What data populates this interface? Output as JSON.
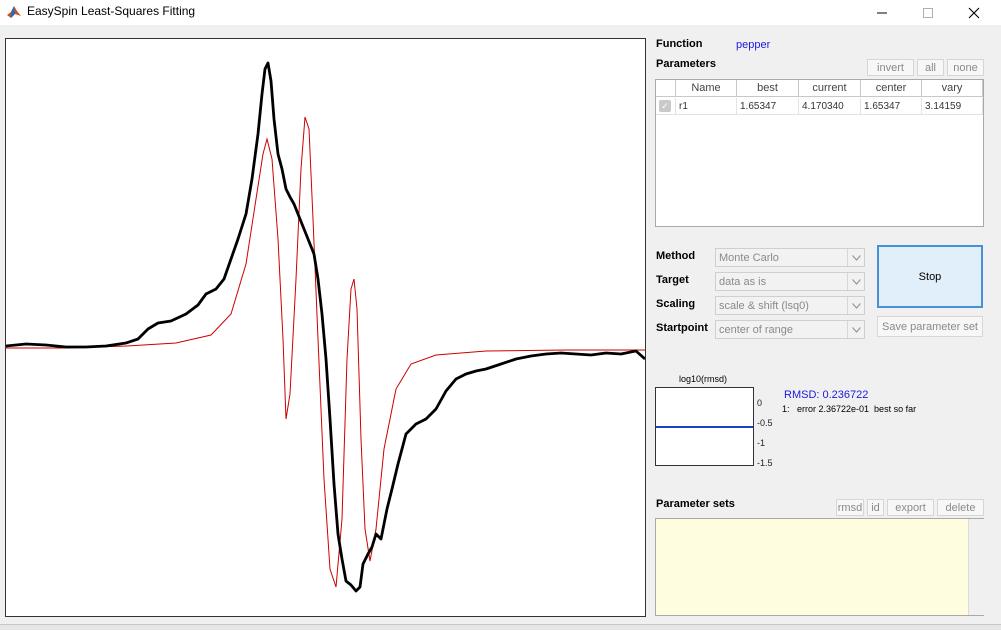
{
  "window": {
    "title": "EasySpin Least-Squares Fitting",
    "icon": "matlab-icon",
    "controls": [
      "minimize-icon",
      "maximize-icon",
      "close-icon"
    ]
  },
  "function": {
    "label": "Function",
    "value": "pepper"
  },
  "parameters": {
    "label": "Parameters",
    "buttons": {
      "invert": "invert",
      "all": "all",
      "none": "none"
    },
    "columns": [
      "Name",
      "best",
      "current",
      "center",
      "vary"
    ],
    "rows": [
      {
        "checked": true,
        "name": "r1",
        "best": "1.65347",
        "current": "4.170340",
        "center": "1.65347",
        "vary": "3.14159"
      }
    ]
  },
  "settings": {
    "method": {
      "label": "Method",
      "value": "Monte Carlo"
    },
    "target": {
      "label": "Target",
      "value": "data as is"
    },
    "scaling": {
      "label": "Scaling",
      "value": "scale & shift (lsq0)"
    },
    "startpoint": {
      "label": "Startpoint",
      "value": "center of range"
    }
  },
  "actions": {
    "stop": "Stop",
    "save_parameter_set": "Save parameter set"
  },
  "rmsd_plot": {
    "title": "log10(rmsd)",
    "yticks": [
      "0",
      "-0.5",
      "-1",
      "-1.5"
    ],
    "rmsd_text": "RMSD: 0.236722",
    "log_line": "1:   error 2.36722e-01  best so far",
    "line_color": "#1f3fc8"
  },
  "parameter_sets": {
    "label": "Parameter sets",
    "buttons": {
      "rmsd": "rmsd",
      "id": "id",
      "export": "export",
      "delete": "delete"
    }
  },
  "colors": {
    "data_trace": "#000000",
    "fit_trace": "#cc0000",
    "function_name": "#1a1ae0",
    "stop_button_border": "#4a90d9",
    "parameter_sets_background": "#fffde0"
  }
}
